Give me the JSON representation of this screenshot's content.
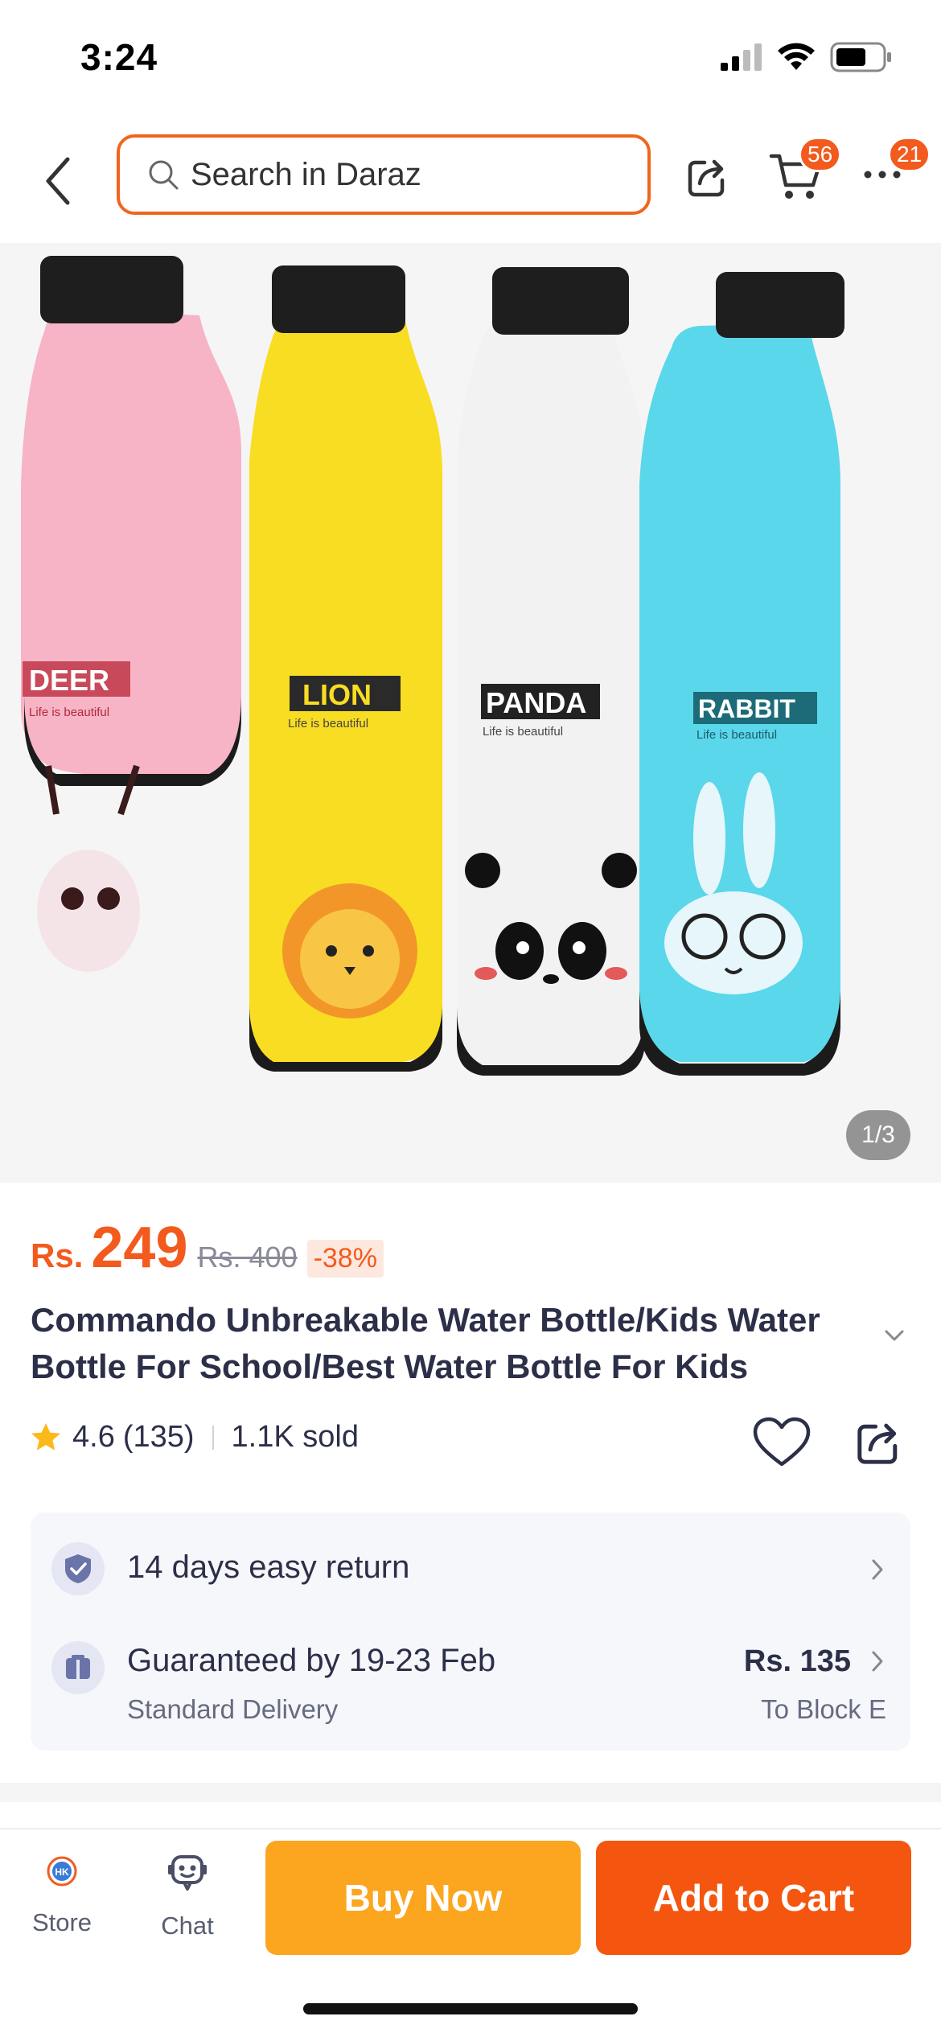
{
  "status_bar": {
    "time": "3:24"
  },
  "header": {
    "search_placeholder": "Search in Daraz",
    "cart_badge": "56",
    "more_badge": "21"
  },
  "gallery": {
    "counter": "1/3",
    "bottles": [
      {
        "label": "DEER",
        "tagline": "Life is beautiful",
        "color": "#f7b4c6"
      },
      {
        "label": "LION",
        "tagline": "Life is beautiful",
        "color": "#f9dd22"
      },
      {
        "label": "PANDA",
        "tagline": "Life is beautiful",
        "color": "#f2f2f2"
      },
      {
        "label": "RABBIT",
        "tagline": "Life is beautiful",
        "color": "#5ad7ea"
      }
    ]
  },
  "product": {
    "currency": "Rs.",
    "price": "249",
    "original_price": "Rs. 400",
    "discount": "-38%",
    "title": "Commando Unbreakable Water Bottle/Kids Water Bottle For School/Best Water Bottle For Kids",
    "rating": "4.6",
    "rating_count": "(135)",
    "sold": "1.1K sold"
  },
  "services": {
    "return_text": "14 days easy return",
    "delivery_text": "Guaranteed by 19-23 Feb",
    "delivery_type": "Standard Delivery",
    "delivery_fee": "Rs. 135",
    "destination": "To Block E"
  },
  "bottom_bar": {
    "store_label": "Store",
    "chat_label": "Chat",
    "buy_now": "Buy Now",
    "add_to_cart": "Add to Cart"
  },
  "colors": {
    "accent": "#f35a1d",
    "buy_now": "#fca51f",
    "add_to_cart": "#f4560f"
  }
}
